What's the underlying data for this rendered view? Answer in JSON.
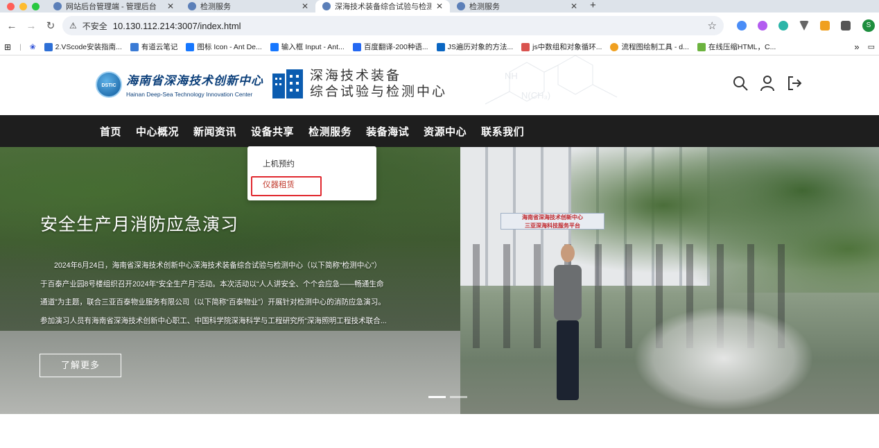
{
  "browser": {
    "tabs": [
      {
        "title": "网站后台管理端 - 管理后台",
        "active": false
      },
      {
        "title": "检测服务",
        "active": false
      },
      {
        "title": "深海技术装备综合试验与检测中",
        "active": true
      },
      {
        "title": "检测服务",
        "active": false
      }
    ],
    "insecure_label": "不安全",
    "url": "10.130.112.214:3007/index.html",
    "bookmarks": [
      {
        "label": "2.VScode安装指南...",
        "color": "#2d6fd6"
      },
      {
        "label": "有道云笔记",
        "color": "#3a7bd5"
      },
      {
        "label": "图标 Icon - Ant De...",
        "color": "#1677ff"
      },
      {
        "label": "输入框 Input - Ant...",
        "color": "#1677ff"
      },
      {
        "label": "百度翻译-200种语...",
        "color": "#2468f2"
      },
      {
        "label": "JS遍历对象的方法...",
        "color": "#0a66c2"
      },
      {
        "label": "js中数组和对象循环...",
        "color": "#d9534f"
      },
      {
        "label": "流程图绘制工具 - d...",
        "color": "#f0a020"
      },
      {
        "label": "在线压缩HTML，C...",
        "color": "#6cb33f"
      }
    ],
    "overflow_label": "»",
    "profile_initial": "S"
  },
  "header": {
    "logo1_emblem": "DSTIC",
    "logo1_cn": "海南省深海技术创新中心",
    "logo1_en": "Hainan Deep-Sea Technology Innovation Center",
    "logo2_line1": "深海技术装备",
    "logo2_line2": "综合试验与检测中心",
    "bg_formula1": "NH",
    "bg_formula2": "N(CH₃)"
  },
  "nav": {
    "items": [
      "首页",
      "中心概况",
      "新闻资讯",
      "设备共享",
      "检测服务",
      "装备海试",
      "资源中心",
      "联系我们"
    ]
  },
  "dropdown": {
    "items": [
      "上机预约",
      "仪器租赁"
    ]
  },
  "hero": {
    "title": "安全生产月消防应急演习",
    "paragraph_lines": [
      "2024年6月24日，海南省深海技术创新中心深海技术装备综合试验与检测中心（以下简称“检测中心”）",
      "于百泰产业园8号楼组织召开2024年“安全生产月”活动。本次活动以“人人讲安全、个个会应急——畅通生命",
      "通道”为主题，联合三亚百泰物业服务有限公司（以下简称“百泰物业”）开展针对检测中心的消防应急演习。",
      "参加演习人员有海南省深海技术创新中心职工、中国科学院深海科学与工程研究所“深海照明工程技术联合..."
    ],
    "more_label": "了解更多",
    "banner_line1": "海南省深海技术创新中心",
    "banner_line2": "三亚深海科技服务平台",
    "slides_total": 2,
    "slide_active": 1
  }
}
